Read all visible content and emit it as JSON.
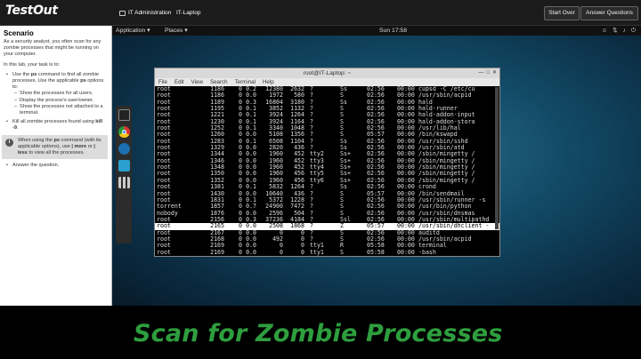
{
  "topbar": {
    "brand": "TestOut",
    "tab_admin": "IT Administration",
    "tab_laptop": "IT-Laptop",
    "start_over": "Start Over",
    "answer_questions": "Answer Questions"
  },
  "scenario": {
    "title": "Scenario",
    "intro": "As a security analyst, you often scan for any zombie processes that might be running on your computer.",
    "task_lead": "In this lab, your task is to:",
    "task1_pre": "Use the ",
    "task1_cmd": "ps",
    "task1_mid": " command to find all zombie processes. Use the applicable ",
    "task1_opt": "ps",
    "task1_post": " options to:",
    "sub": [
      "Show the processes for all users.",
      "Display the process's user/owner.",
      "Show the processes not attached to a terminal."
    ],
    "task2_pre": "Kill all zombie processes found using ",
    "task2_cmd": "kill -9",
    "task2_post": ".",
    "hint_pre": "When using the ",
    "hint_cmd": "ps",
    "hint_mid1": " command (with its applicable options), use ",
    "hint_more": "| more",
    "hint_mid2": " or ",
    "hint_less": "| less",
    "hint_post": " to view all the processes.",
    "task3": "Answer the question."
  },
  "desktop": {
    "applications": "Application ▾",
    "places": "Places ▾",
    "clock": "Sun 17:58"
  },
  "terminal": {
    "title": "root@IT-Laptop: ~",
    "menu": [
      "File",
      "Edit",
      "View",
      "Search",
      "Terminal",
      "Help"
    ],
    "rows": [
      [
        "root",
        "1186",
        "0",
        "0.2",
        "12380",
        "2632",
        "?",
        "Ss",
        "02:56",
        "00:00",
        "cupsd -C /etc/cu"
      ],
      [
        "root",
        "1186",
        "0",
        "0.0",
        "1972",
        "580",
        "?",
        "S",
        "02:56",
        "00:00",
        "/usr/sbin/acpid"
      ],
      [
        "root",
        "1189",
        "0",
        "0.3",
        "16804",
        "3180",
        "?",
        "Ss",
        "02:56",
        "00:00",
        "hald"
      ],
      [
        "root",
        "1195",
        "0",
        "0.1",
        "3852",
        "1132",
        "?",
        "S",
        "02:56",
        "00:00",
        "hald-runner"
      ],
      [
        "root",
        "1221",
        "0",
        "0.1",
        "3924",
        "1264",
        "?",
        "S",
        "02:56",
        "00:00",
        "hald-addon-input"
      ],
      [
        "root",
        "1230",
        "0",
        "0.1",
        "3924",
        "1164",
        "?",
        "S",
        "02:56",
        "00:00",
        "hald-addon-stora"
      ],
      [
        "root",
        "1252",
        "0",
        "0.1",
        "3340",
        "1048",
        "?",
        "S",
        "02:56",
        "00:00",
        "/usr/lib/hal"
      ],
      [
        "root",
        "1260",
        "0",
        "0.0",
        "5108",
        "1356",
        "?",
        "S",
        "05:57",
        "00:00",
        "/bin/kswapd"
      ],
      [
        "root",
        "1283",
        "0",
        "0.1",
        "6508",
        "1104",
        "?",
        "Ss",
        "02:56",
        "00:00",
        "/usr/sbin/sshd"
      ],
      [
        "root",
        "1329",
        "0",
        "0.0",
        "2820",
        "436",
        "?",
        "Ss",
        "02:56",
        "00:00",
        "/usr/sbin/atd"
      ],
      [
        "root",
        "1344",
        "0",
        "0.0",
        "1960",
        "452",
        "tty2",
        "Ss+",
        "02:56",
        "00:00",
        "/sbin/mingetty /"
      ],
      [
        "root",
        "1346",
        "0",
        "0.0",
        "1960",
        "452",
        "tty3",
        "Ss+",
        "02:56",
        "00:00",
        "/sbin/mingetty /"
      ],
      [
        "root",
        "1348",
        "0",
        "0.0",
        "1960",
        "452",
        "tty4",
        "Ss+",
        "02:56",
        "00:00",
        "/sbin/mingetty /"
      ],
      [
        "root",
        "1350",
        "0",
        "0.0",
        "1960",
        "456",
        "tty5",
        "Ss+",
        "02:56",
        "00:00",
        "/sbin/mingetty /"
      ],
      [
        "root",
        "1352",
        "0",
        "0.0",
        "1960",
        "456",
        "tty6",
        "Ss+",
        "02:56",
        "00:00",
        "/sbin/mingetty /"
      ],
      [
        "root",
        "1381",
        "0",
        "0.1",
        "5832",
        "1264",
        "?",
        "Ss",
        "02:56",
        "00:00",
        "crond"
      ],
      [
        "root",
        "1430",
        "0",
        "0.0",
        "10640",
        "436",
        "?",
        "S",
        "05:57",
        "00:00",
        "/bin/sendmail"
      ],
      [
        "root",
        "1831",
        "0",
        "0.1",
        "5372",
        "1228",
        "?",
        "S",
        "02:56",
        "00:00",
        "/usr/sbin/runner -s"
      ],
      [
        "torrent",
        "1857",
        "0",
        "0.7",
        "24900",
        "7472",
        "?",
        "S",
        "02:56",
        "00:00",
        "/usr/bin/python"
      ],
      [
        "nobody",
        "1876",
        "0",
        "0.0",
        "2596",
        "504",
        "?",
        "S",
        "02:56",
        "00:00",
        "/usr/sbin/dnsmas"
      ],
      [
        "root",
        "2156",
        "0",
        "0.3",
        "37236",
        "4184",
        "?",
        "Ssl",
        "02:56",
        "00:00",
        "/usr/sbin/multipathd"
      ],
      [
        "root",
        "2165",
        "0",
        "0.0",
        "2508",
        "1868",
        "?",
        "Z",
        "05:57",
        "00:00",
        "/usr/sbin/dhclient -"
      ],
      [
        "root",
        "2167",
        "0",
        "0.0",
        "0",
        "0",
        "?",
        "S",
        "02:56",
        "00:00",
        "auditd"
      ],
      [
        "root",
        "2168",
        "0",
        "0.0",
        "492",
        "0",
        "?",
        "S",
        "02:56",
        "00:00",
        "/usr/sbin/acpid"
      ],
      [
        "root",
        "2169",
        "0",
        "0.0",
        "0",
        "0",
        "tty1",
        "R",
        "05:58",
        "00:00",
        "terminal"
      ],
      [
        "root",
        "2169",
        "0",
        "0.0",
        "0",
        "0",
        "tty1",
        "S",
        "05:58",
        "00:00",
        "-bash"
      ],
      [
        "root",
        "2171",
        "0",
        "0.0",
        "0",
        "0",
        "tty1",
        "R",
        "05:58",
        "00:00",
        "ps aux"
      ]
    ],
    "selected_row": 21
  },
  "footer": {
    "title": "Scan for Zombie Processes"
  }
}
